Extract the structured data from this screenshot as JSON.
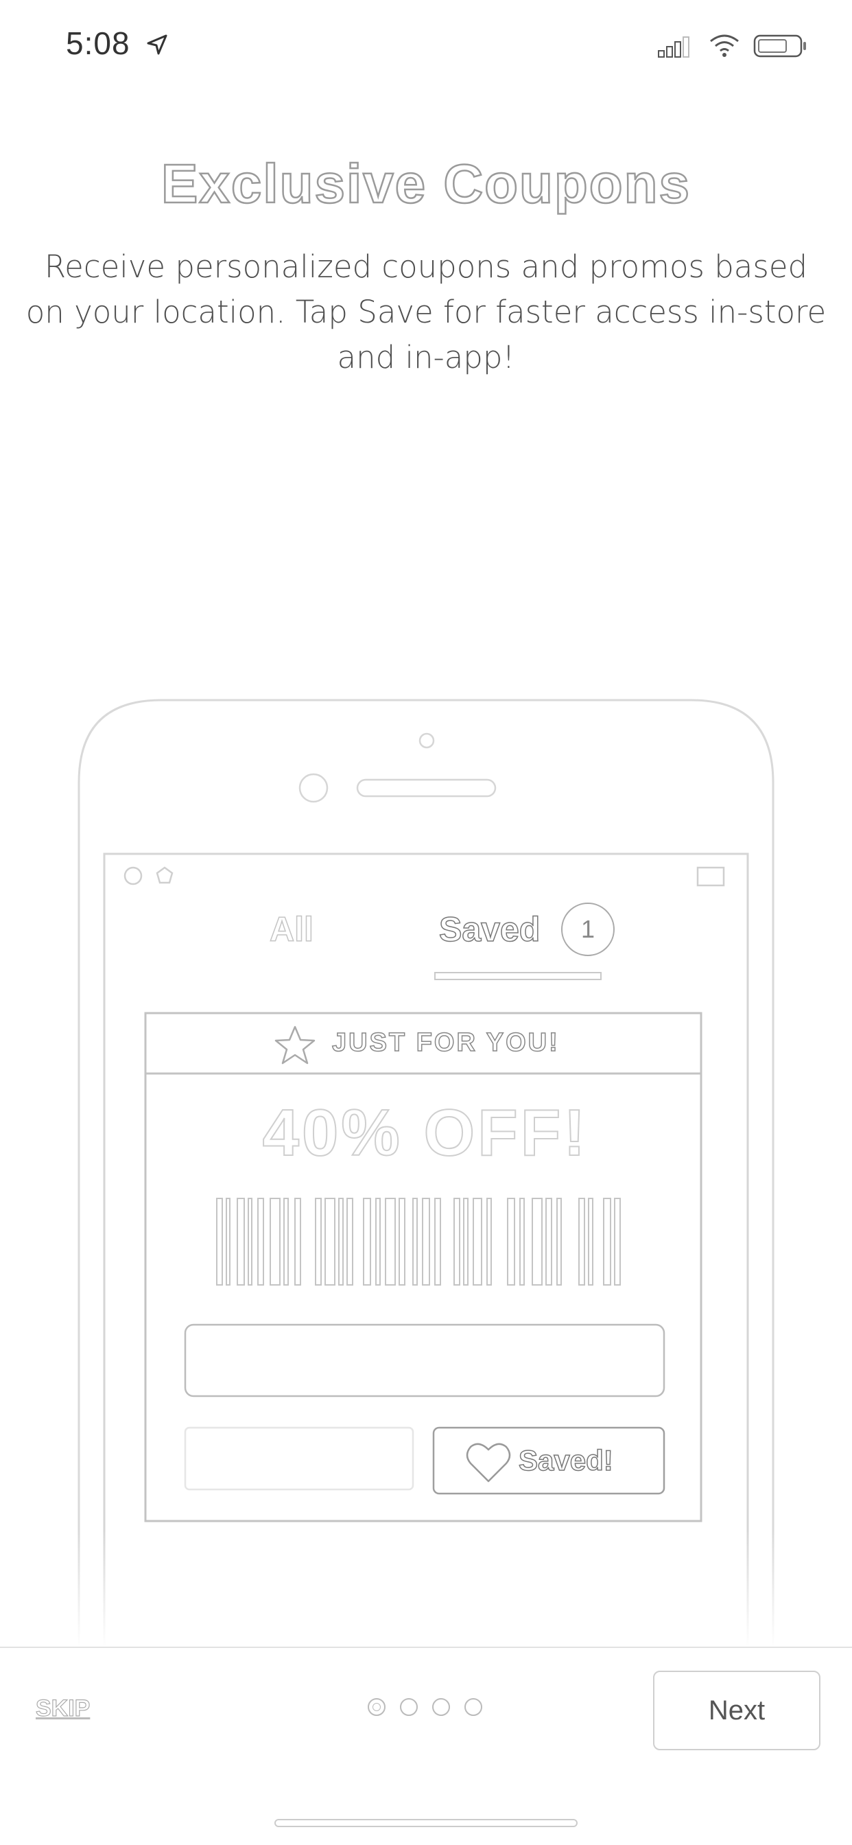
{
  "status_bar": {
    "time": "5:08",
    "icons": [
      "location-arrow-icon",
      "signal-icon",
      "wifi-icon",
      "battery-icon"
    ]
  },
  "onboarding": {
    "title": "Exclusive Coupons",
    "description": "Receive personalized coupons and promos based on your location. Tap Save for faster access in-store and in-app!"
  },
  "illustration": {
    "tabs": {
      "all_label": "All",
      "saved_label": "Saved",
      "saved_count": "1"
    },
    "coupon": {
      "header": "JUST FOR YOU!",
      "discount": "40% OFF!",
      "saved_button_label": "Saved!"
    }
  },
  "footer": {
    "skip_label": "SKIP",
    "page_count": 4,
    "active_page": 1,
    "next_label": "Next"
  },
  "colors": {
    "background": "#ffffff",
    "outline": "#9a9a9a",
    "light_outline": "#d6d6d6",
    "text": "#4f4f4f"
  }
}
